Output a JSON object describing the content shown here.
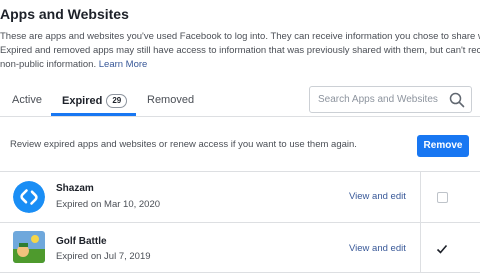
{
  "header": {
    "title": "Apps and Websites",
    "description_line1": "These are apps and websites you've used Facebook to log into. They can receive information you chose to share wit",
    "description_line2": "Expired and removed apps may still have access to information that was previously shared with them, but can't recei",
    "description_line3": "non-public information.",
    "learn_more": "Learn More"
  },
  "tabs": {
    "active": "Active",
    "expired": "Expired",
    "expired_count": "29",
    "removed": "Removed"
  },
  "search": {
    "placeholder": "Search Apps and Websites"
  },
  "notice": {
    "text": "Review expired apps and websites or renew access if you want to use them again.",
    "remove_button": "Remove"
  },
  "apps": [
    {
      "name": "Shazam",
      "status": "Expired on Mar 10, 2020",
      "action": "View and edit",
      "selected": false,
      "icon": "shazam-logo"
    },
    {
      "name": "Golf Battle",
      "status": "Expired on Jul 7, 2019",
      "action": "View and edit",
      "selected": true,
      "icon": "golf-battle-icon"
    }
  ],
  "colors": {
    "accent": "#1877f2",
    "link": "#385898",
    "shazam": "#1a8ef5"
  }
}
